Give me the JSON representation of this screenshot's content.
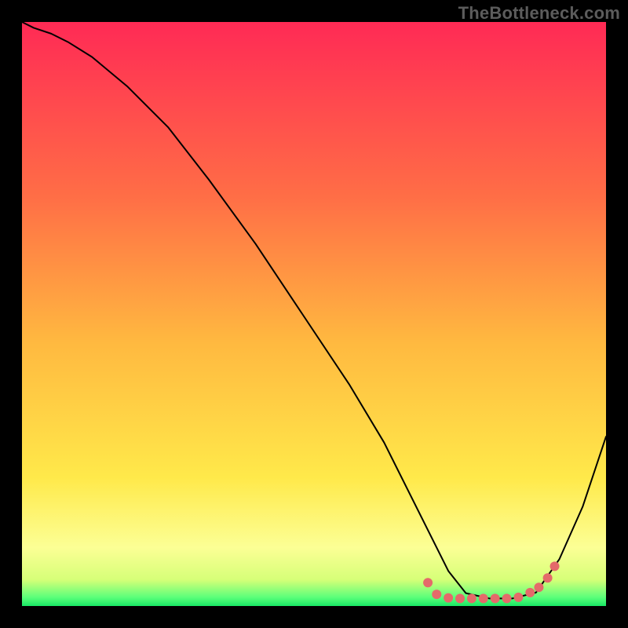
{
  "watermark": "TheBottleneck.com",
  "chart_data": {
    "type": "line",
    "title": "",
    "xlabel": "",
    "ylabel": "",
    "xlim": [
      0,
      100
    ],
    "ylim": [
      0,
      100
    ],
    "background_gradient": {
      "top": "#ff2a55",
      "mid1": "#ff8a3c",
      "mid2": "#ffd23c",
      "band": "#fbff8e",
      "bottom": "#29ff76"
    },
    "gradient_stops": [
      {
        "offset": 0.0,
        "color": "#ff2a55"
      },
      {
        "offset": 0.3,
        "color": "#ff6e46"
      },
      {
        "offset": 0.55,
        "color": "#ffb940"
      },
      {
        "offset": 0.78,
        "color": "#ffe94a"
      },
      {
        "offset": 0.9,
        "color": "#fcff95"
      },
      {
        "offset": 0.955,
        "color": "#d6ff78"
      },
      {
        "offset": 0.985,
        "color": "#5cff7a"
      },
      {
        "offset": 1.0,
        "color": "#18e865"
      }
    ],
    "series": [
      {
        "name": "curve",
        "color": "#000000",
        "width": 2.0,
        "x": [
          0,
          2,
          5,
          8,
          12,
          18,
          25,
          32,
          40,
          48,
          56,
          62,
          66,
          70,
          73,
          76,
          80,
          84,
          88,
          92,
          96,
          100
        ],
        "y": [
          100,
          99,
          98,
          96.5,
          94,
          89,
          82,
          73,
          62,
          50,
          38,
          28,
          20,
          12,
          6,
          2.2,
          1.3,
          1.3,
          2.3,
          8,
          17,
          29
        ]
      }
    ],
    "markers": {
      "name": "low-band-dots",
      "color": "#e46a6a",
      "radius": 6,
      "x": [
        69.5,
        71,
        73,
        75,
        77,
        79,
        81,
        83,
        85,
        87,
        88.5,
        90,
        91.2
      ],
      "y": [
        4.0,
        2.0,
        1.4,
        1.3,
        1.3,
        1.3,
        1.3,
        1.3,
        1.5,
        2.3,
        3.2,
        4.8,
        6.8
      ]
    }
  }
}
